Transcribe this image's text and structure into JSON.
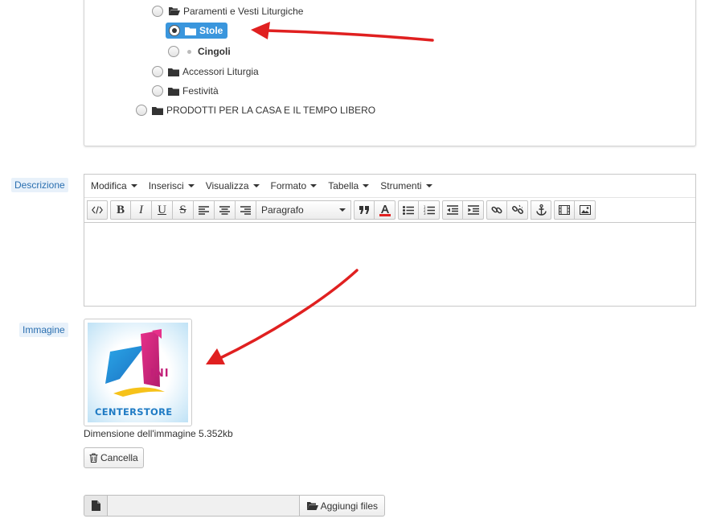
{
  "tree": {
    "items": [
      {
        "label": "Paramenti e Vesti Liturgiche"
      },
      {
        "label": "Stole"
      },
      {
        "label": "Cingoli"
      },
      {
        "label": "Accessori Liturgia"
      },
      {
        "label": "Festività"
      },
      {
        "label": "PRODOTTI PER LA CASA E IL TEMPO LIBERO"
      }
    ]
  },
  "description": {
    "label": "Descrizione",
    "menu": [
      "Modifica",
      "Inserisci",
      "Visualizza",
      "Formato",
      "Tabella",
      "Strumenti"
    ],
    "format_value": "Paragrafo"
  },
  "image": {
    "label": "Immagine",
    "logo_text": "CENTERSTORE",
    "logo_letters": "INI",
    "size_text": "Dimensione dell'immagine 5.352kb",
    "delete_label": "Cancella",
    "add_files_label": "Aggiungi files"
  },
  "colors": {
    "selected_bg": "#3a96dd",
    "label_text": "#2a6fb0",
    "annotation_arrow": "#e02020"
  }
}
